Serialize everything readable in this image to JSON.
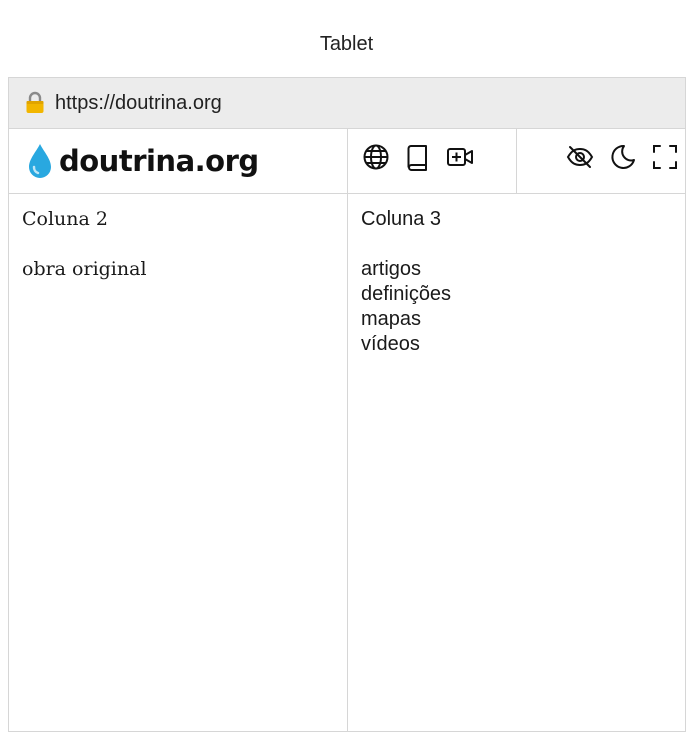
{
  "caption": "Tablet",
  "browser": {
    "url": "https://doutrina.org",
    "lock_icon": "lock-icon"
  },
  "header": {
    "brand": "doutrina.org",
    "logo_icon": "water-drop-icon",
    "nav_icons": [
      "globe-icon",
      "book-icon",
      "video-add-icon"
    ],
    "tool_icons": [
      "eye-off-icon",
      "moon-icon",
      "fullscreen-icon"
    ],
    "accent_color": "#29a8e0"
  },
  "column2": {
    "title": "Coluna 2",
    "item": "obra original"
  },
  "column3": {
    "title": "Coluna 3",
    "items": [
      "artigos",
      "definições",
      "mapas",
      "vídeos"
    ]
  }
}
